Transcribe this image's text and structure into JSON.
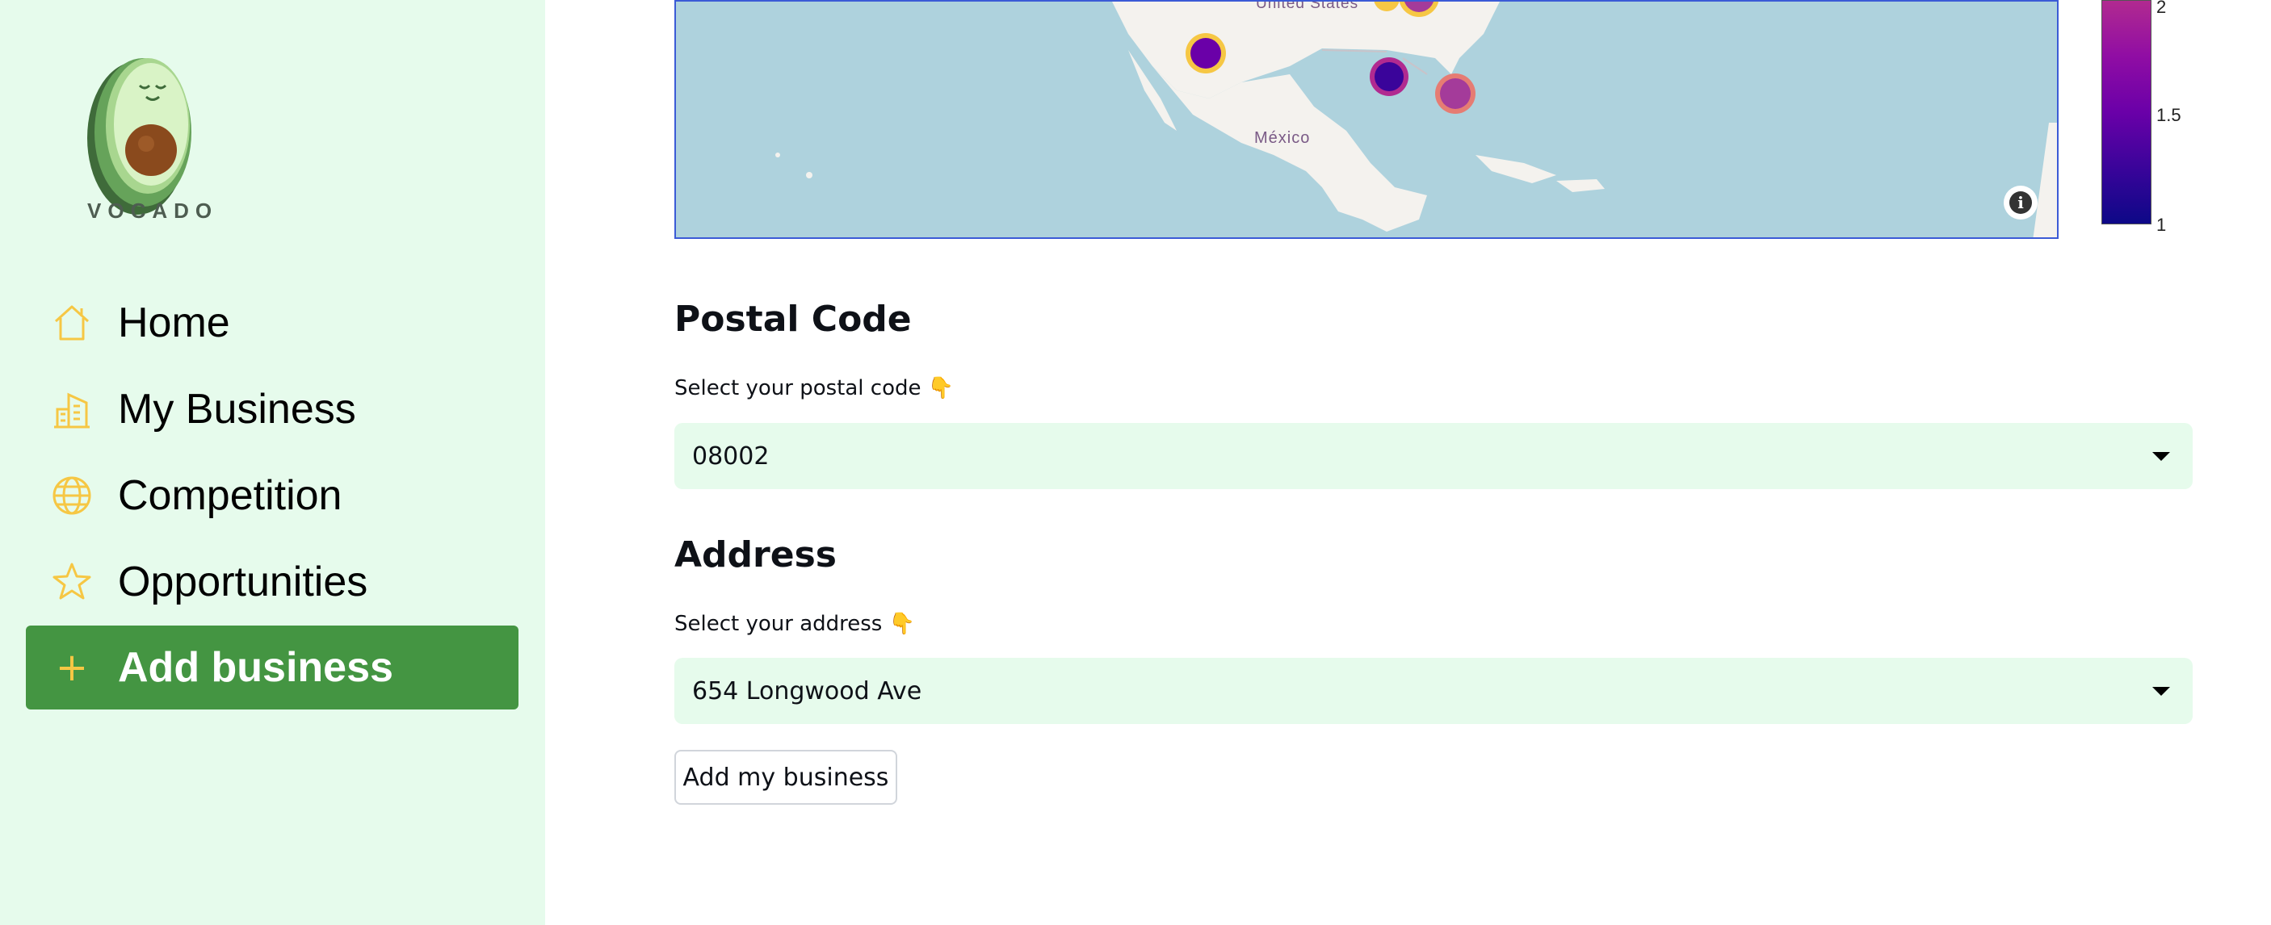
{
  "brand": {
    "name": "VOCADO"
  },
  "sidebar": {
    "items": [
      {
        "label": "Home",
        "icon": "home-icon"
      },
      {
        "label": "My Business",
        "icon": "building-icon"
      },
      {
        "label": "Competition",
        "icon": "globe-icon"
      },
      {
        "label": "Opportunities",
        "icon": "star-icon"
      },
      {
        "label": "Add business",
        "icon": "plus-icon",
        "active": true
      }
    ]
  },
  "map": {
    "labels": {
      "us": "United States",
      "mexico": "México"
    },
    "colorbar": {
      "ticks": [
        "2",
        "1.5",
        "1"
      ],
      "colors": [
        "#0d0887",
        "#6a00a8",
        "#b12a90"
      ]
    },
    "markers": [
      {
        "value": 1.3
      },
      {
        "value": 1.9
      },
      {
        "value": 1.0
      },
      {
        "value": 1.8
      },
      {
        "value": 2.0
      }
    ]
  },
  "form": {
    "postal": {
      "heading": "Postal Code",
      "label": "Select your postal code 👇",
      "value": "08002"
    },
    "address": {
      "heading": "Address",
      "label": "Select your address 👇",
      "value": "654 Longwood Ave"
    },
    "submit_label": "Add my business"
  },
  "colors": {
    "accent": "#449542",
    "sidebar_bg": "#e6fbec",
    "icon": "#f6c744"
  }
}
